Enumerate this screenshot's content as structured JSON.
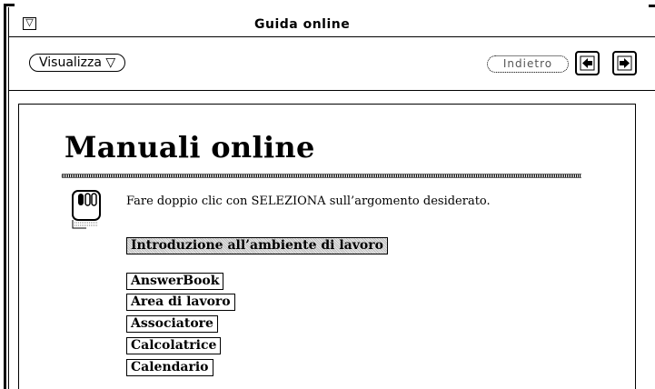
{
  "window": {
    "title": "Guida online",
    "menu_mark": "▽"
  },
  "controls": {
    "view_button": "Visualizza ▽",
    "back_button": "Indietro",
    "prev_icon": "arrow-left-icon",
    "next_icon": "arrow-right-icon"
  },
  "content": {
    "heading": "Manuali online",
    "instruction": "Fare doppio clic con SELEZIONA sull’argomento desiderato.",
    "mouse_icon": "mouse-icon",
    "topics": [
      {
        "label": "Introduzione all’ambiente di lavoro",
        "selected": true
      },
      {
        "label": "AnswerBook",
        "selected": false
      },
      {
        "label": "Area di lavoro",
        "selected": false
      },
      {
        "label": "Associatore",
        "selected": false
      },
      {
        "label": "Calcolatrice",
        "selected": false
      },
      {
        "label": "Calendario",
        "selected": false
      }
    ]
  }
}
